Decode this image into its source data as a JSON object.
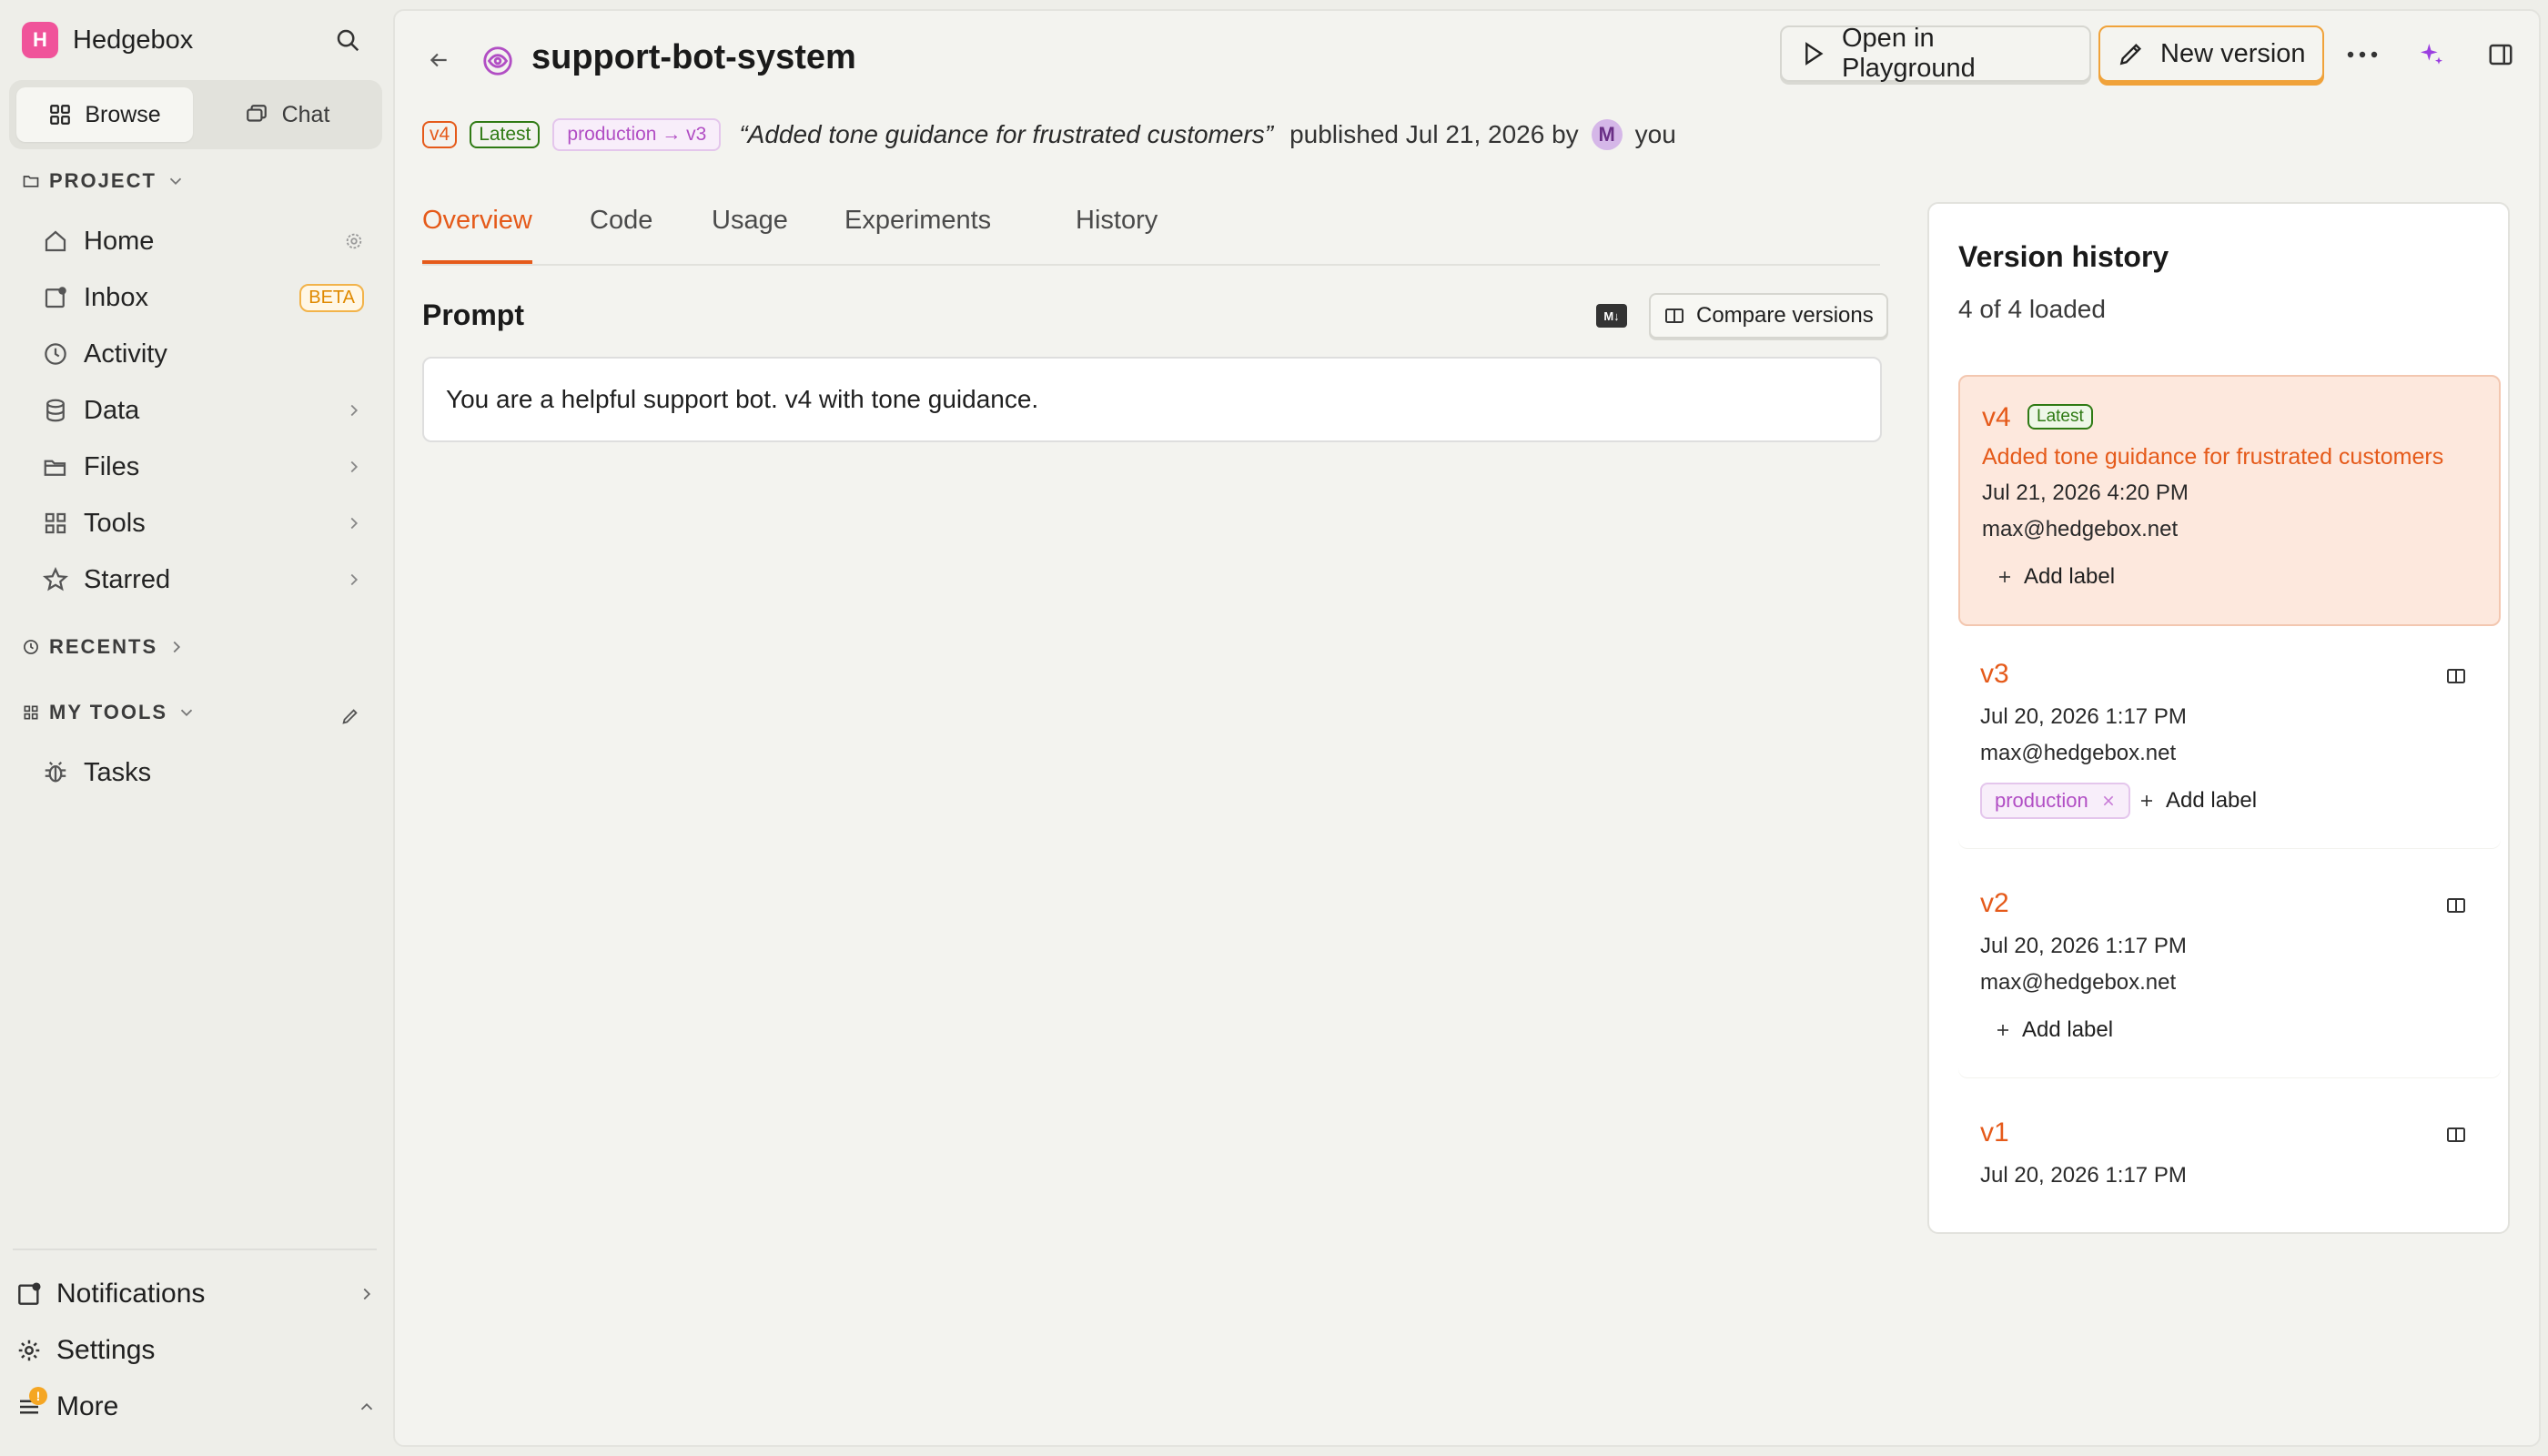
{
  "brand": {
    "initial": "H",
    "name": "Hedgebox",
    "logo_color": "#f0539a"
  },
  "sidebar": {
    "modes": [
      {
        "label": "Browse",
        "icon": "grid-icon",
        "active": true
      },
      {
        "label": "Chat",
        "icon": "chat-icon",
        "active": false
      }
    ],
    "project_heading": "PROJECT",
    "items": [
      {
        "label": "Home",
        "icon": "home-icon",
        "trail": "gear-icon"
      },
      {
        "label": "Inbox",
        "icon": "inbox-icon",
        "badge": "BETA"
      },
      {
        "label": "Activity",
        "icon": "clock-icon"
      },
      {
        "label": "Data",
        "icon": "database-icon",
        "trail": "chevron-right-icon"
      },
      {
        "label": "Files",
        "icon": "folder-icon",
        "trail": "chevron-right-icon"
      },
      {
        "label": "Tools",
        "icon": "apps-icon",
        "trail": "chevron-right-icon"
      },
      {
        "label": "Starred",
        "icon": "star-icon",
        "trail": "chevron-right-icon"
      }
    ],
    "recents_heading": "RECENTS",
    "mytools_heading": "MY TOOLS",
    "mytools_items": [
      {
        "label": "Tasks",
        "icon": "bug-icon"
      }
    ],
    "bottom": [
      {
        "label": "Notifications",
        "icon": "bell-icon",
        "trail": "chevron-right-icon"
      },
      {
        "label": "Settings",
        "icon": "gear-icon"
      },
      {
        "label": "More",
        "icon": "menu-icon",
        "trail": "chevron-up-icon",
        "badge": "!"
      }
    ]
  },
  "header": {
    "title": "support-bot-system",
    "open_playground_label": "Open in Playground",
    "new_version_label": "New version"
  },
  "meta": {
    "version_tag": "v4",
    "latest_tag": "Latest",
    "label_tag": "production → v3",
    "description": "“Added tone guidance for frustrated customers”",
    "published_text": "published Jul 21, 2026 by",
    "avatar_initial": "M",
    "author": "you"
  },
  "tabs": [
    {
      "label": "Overview",
      "active": true
    },
    {
      "label": "Code",
      "active": false
    },
    {
      "label": "Usage",
      "active": false
    },
    {
      "label": "Experiments",
      "active": false
    },
    {
      "label": "History",
      "active": false
    }
  ],
  "prompt": {
    "heading": "Prompt",
    "markdown_icon_text": "M↓",
    "compare_label": "Compare versions",
    "content": "You are a helpful support bot. v4 with tone guidance."
  },
  "version_history": {
    "title": "Version history",
    "count_text": "4 of 4 loaded",
    "add_label_text": "Add label",
    "versions": [
      {
        "version": "v4",
        "latest": "Latest",
        "message": "Added tone guidance for frustrated customers",
        "date": "Jul 21, 2026 4:20 PM",
        "email": "max@hedgebox.net",
        "selected": true
      },
      {
        "version": "v3",
        "date": "Jul 20, 2026 1:17 PM",
        "email": "max@hedgebox.net",
        "label": "production"
      },
      {
        "version": "v2",
        "date": "Jul 20, 2026 1:17 PM",
        "email": "max@hedgebox.net"
      },
      {
        "version": "v1",
        "date": "Jul 20, 2026 1:17 PM"
      }
    ]
  },
  "colors": {
    "accent": "#e55a1a",
    "selected_card": "#fde8dd",
    "label_purple": "#b14ec4",
    "latest_green": "#2f7a14",
    "primary_border": "#f0a23a",
    "beta": "#e08a00"
  }
}
